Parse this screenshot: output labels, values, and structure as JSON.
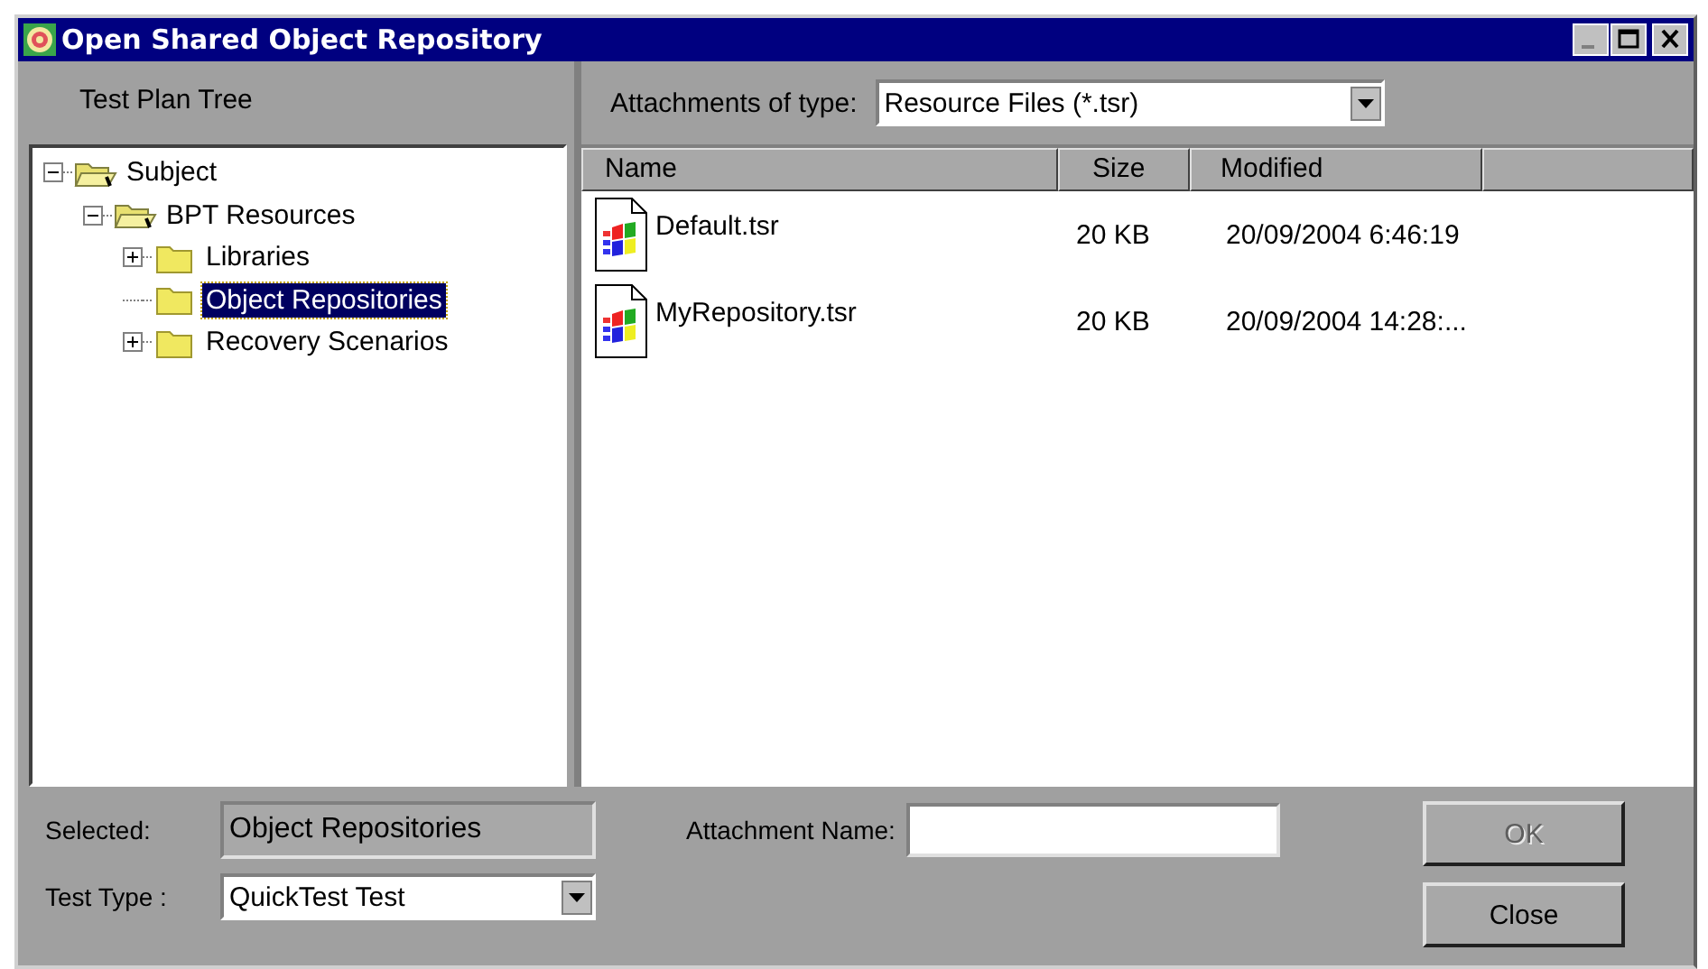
{
  "window": {
    "title": "Open Shared Object Repository"
  },
  "tree": {
    "heading": "Test Plan Tree",
    "nodes": [
      {
        "label": "Subject",
        "expanded": true,
        "selected": false,
        "children": [
          {
            "label": "BPT Resources",
            "expanded": true,
            "selected": false,
            "children": [
              {
                "label": "Libraries",
                "expanded": false,
                "selected": false
              },
              {
                "label": "Object Repositories",
                "selected": true
              },
              {
                "label": "Recovery Scenarios",
                "expanded": false,
                "selected": false
              }
            ]
          }
        ]
      }
    ]
  },
  "filter": {
    "label": "Attachments of type:",
    "value": "Resource Files (*.tsr)"
  },
  "table": {
    "columns": [
      "Name",
      "Size",
      "Modified"
    ],
    "rows": [
      {
        "name": "Default.tsr",
        "size": "20 KB",
        "modified": "20/09/2004 6:46:19"
      },
      {
        "name": "MyRepository.tsr",
        "size": "20 KB",
        "modified": "20/09/2004 14:28:..."
      }
    ]
  },
  "selected": {
    "label": "Selected:",
    "value": "Object Repositories"
  },
  "test_type": {
    "label": "Test Type :",
    "value": "QuickTest Test"
  },
  "attachment_name": {
    "label": "Attachment Name:"
  },
  "buttons": [
    {
      "label": "OK",
      "disabled": true
    },
    {
      "label": "Close",
      "disabled": false
    }
  ]
}
